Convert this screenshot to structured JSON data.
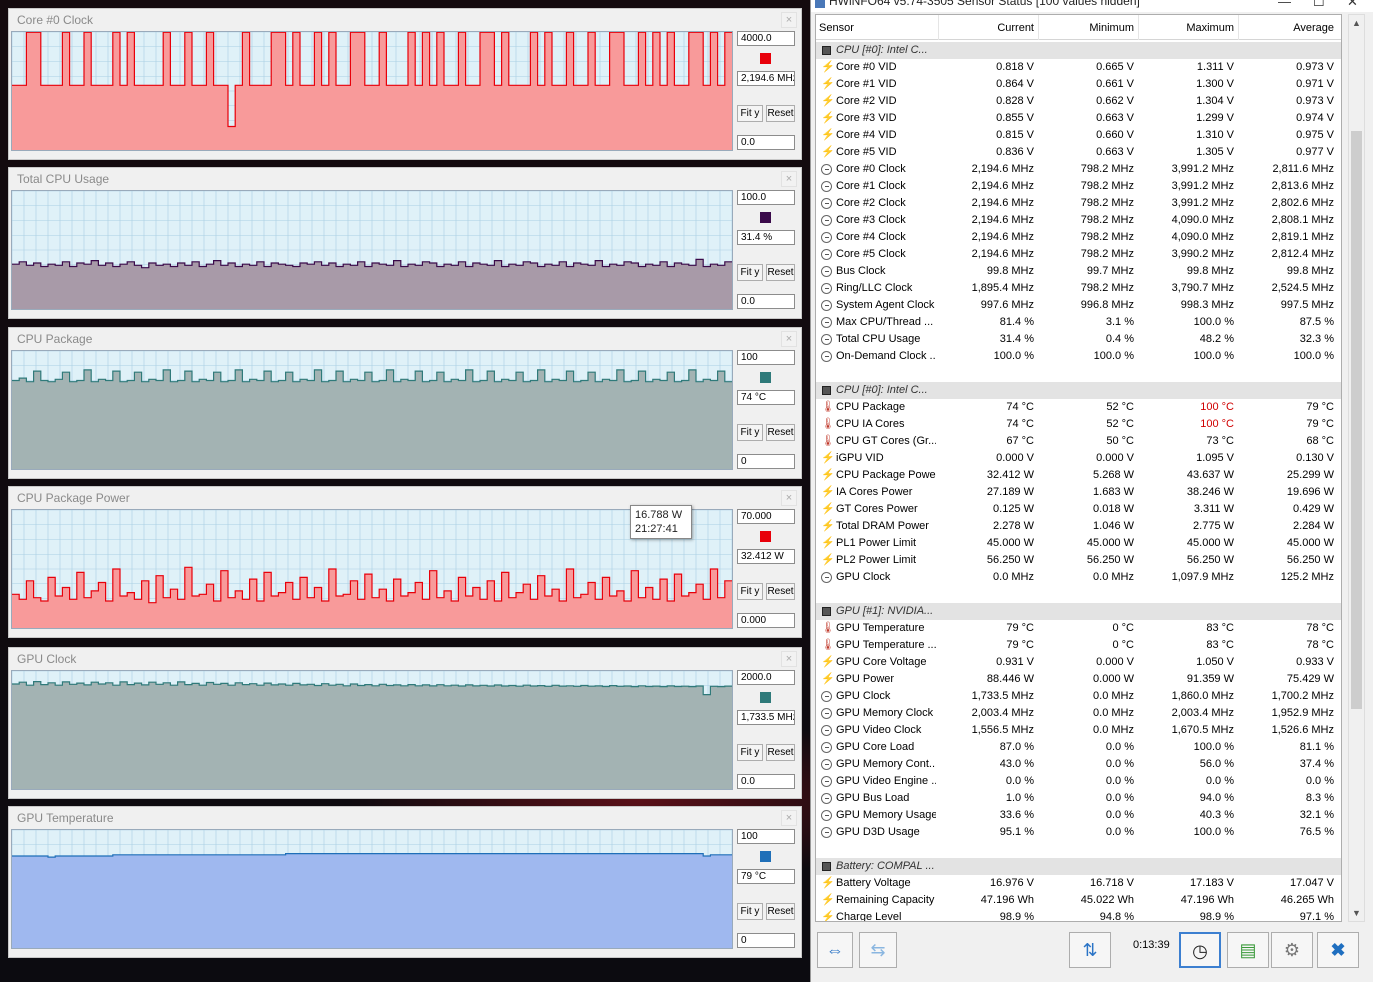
{
  "graphs": [
    {
      "title": "Core #0 Clock",
      "max": "4000.0",
      "current": "2,194.6 MHz",
      "min": "0.0",
      "color": "#e8000a",
      "fill": "#f89a9a",
      "bg": "#dff1f8",
      "series": [
        2194.6,
        2194.6,
        3990,
        3990,
        2194.6,
        2194.6,
        2194.6,
        3990,
        2194.6,
        2194.6,
        3990,
        2194.6,
        2194.6,
        2194.6,
        3990,
        2194.6,
        3990,
        2194.6,
        2194.6,
        2194.6,
        2194.6,
        3990,
        2194.6,
        2194.6,
        3990,
        2194.6,
        2194.6,
        3990,
        2194.6,
        2194.6,
        798,
        2194.6,
        3990,
        2194.6,
        2194.6,
        2194.6,
        3990,
        3990,
        2194.6,
        3990,
        2194.6,
        2194.6,
        3990,
        2194.6,
        3990,
        2194.6,
        2194.6,
        3990,
        3990,
        2194.6,
        2194.6,
        3990,
        2194.6,
        2194.6,
        2194.6,
        3990,
        2194.6,
        3990,
        2194.6,
        3990,
        2194.6,
        2194.6,
        3990,
        2194.6,
        2194.6,
        3990,
        3990,
        2194.6,
        3990,
        2194.6,
        2194.6,
        2194.6,
        3990,
        2194.6,
        3990,
        2194.6,
        2194.6,
        3990,
        2194.6,
        2194.6,
        3990,
        2194.6,
        2194.6,
        3990,
        3990,
        2194.6,
        2194.6,
        3990,
        2194.6,
        3990,
        2194.6,
        3990,
        2194.6,
        2194.6,
        3990,
        3990,
        2194.6,
        3990,
        2194.6,
        3990
      ]
    },
    {
      "title": "Total CPU Usage",
      "max": "100.0",
      "current": "31.4 %",
      "min": "0.0",
      "color": "#3a0a4a",
      "fill": "#a89aa8",
      "bg": "#dff1f8",
      "series": [
        38,
        40,
        37,
        39,
        36,
        38,
        37,
        40,
        36,
        39,
        38,
        41,
        37,
        39,
        36,
        38,
        40,
        37,
        35,
        39,
        37,
        38,
        36,
        39,
        37,
        40,
        36,
        38,
        41,
        37,
        39,
        36,
        38,
        37,
        40,
        36,
        39,
        38,
        37,
        36,
        39,
        38,
        40,
        37,
        39,
        36,
        38,
        37,
        40,
        36,
        39,
        38,
        37,
        41,
        36,
        38,
        37,
        40,
        39,
        36,
        38,
        37,
        40,
        36,
        39,
        38,
        37,
        41,
        36,
        38,
        37,
        40,
        39,
        36,
        38,
        37,
        40,
        36,
        39,
        38,
        37,
        41,
        36,
        38,
        37,
        40,
        39,
        36,
        38,
        37,
        40,
        36,
        39,
        38,
        37,
        42,
        36,
        38,
        37,
        40
      ]
    },
    {
      "title": "CPU Package",
      "max": "100",
      "current": "74 °C",
      "min": "0",
      "color": "#2f7a7a",
      "fill": "#a3b3b3",
      "bg": "#dff1f8",
      "series": [
        75,
        77,
        74,
        83,
        75,
        74,
        76,
        82,
        74,
        75,
        84,
        74,
        76,
        75,
        83,
        74,
        75,
        82,
        74,
        76,
        75,
        84,
        74,
        75,
        83,
        74,
        76,
        75,
        82,
        74,
        75,
        84,
        74,
        76,
        75,
        83,
        74,
        75,
        82,
        74,
        76,
        75,
        84,
        74,
        75,
        83,
        74,
        76,
        75,
        82,
        74,
        75,
        84,
        74,
        76,
        75,
        83,
        74,
        75,
        82,
        74,
        76,
        75,
        84,
        74,
        75,
        83,
        74,
        76,
        75,
        82,
        74,
        75,
        84,
        74,
        76,
        75,
        83,
        74,
        75,
        82,
        74,
        76,
        75,
        84,
        74,
        75,
        83,
        74,
        76,
        75,
        82,
        74,
        75,
        84,
        74,
        76,
        75,
        83,
        74
      ]
    },
    {
      "title": "CPU Package Power",
      "max": "70.000",
      "current": "32.412 W",
      "min": "0.000",
      "color": "#e8000a",
      "fill": "#f89a9a",
      "bg": "#dff1f8",
      "series": [
        20,
        17,
        28,
        18,
        16,
        30,
        19,
        24,
        17,
        33,
        18,
        22,
        27,
        16,
        35,
        19,
        21,
        17,
        28,
        15,
        31,
        18,
        23,
        17,
        36,
        19,
        20,
        26,
        16,
        34,
        18,
        22,
        17,
        29,
        16,
        33,
        19,
        21,
        27,
        17,
        30,
        18,
        24,
        16,
        35,
        19,
        20,
        28,
        17,
        32,
        18,
        23,
        16,
        29,
        19,
        21,
        27,
        17,
        34,
        18,
        22,
        16,
        30,
        19,
        24,
        17,
        28,
        16,
        33,
        18,
        21,
        26,
        17,
        31,
        19,
        23,
        16,
        35,
        18,
        20,
        27,
        17,
        30,
        19,
        22,
        16,
        34,
        18,
        24,
        17,
        29,
        16,
        32,
        19,
        21,
        26,
        17,
        35,
        18,
        28
      ]
    },
    {
      "title": "GPU Clock",
      "max": "2000.0",
      "current": "1,733.5 MHz",
      "min": "0.0",
      "color": "#2f7a7a",
      "fill": "#a3b3b3",
      "bg": "#dff1f8",
      "series": [
        1780,
        1810,
        1760,
        1820,
        1770,
        1800,
        1760,
        1815,
        1775,
        1795,
        1765,
        1810,
        1780,
        1800,
        1760,
        1815,
        1770,
        1795,
        1765,
        1810,
        1775,
        1800,
        1760,
        1815,
        1770,
        1790,
        1760,
        1805,
        1775,
        1790,
        1760,
        1800,
        1770,
        1785,
        1760,
        1795,
        1765,
        1780,
        1760,
        1790,
        1765,
        1775,
        1755,
        1785,
        1760,
        1775,
        1750,
        1780,
        1755,
        1770,
        1750,
        1775,
        1755,
        1765,
        1750,
        1770,
        1750,
        1765,
        1748,
        1768,
        1750,
        1760,
        1745,
        1765,
        1748,
        1758,
        1745,
        1762,
        1746,
        1755,
        1742,
        1760,
        1745,
        1752,
        1740,
        1758,
        1744,
        1750,
        1740,
        1755,
        1742,
        1748,
        1738,
        1752,
        1740,
        1746,
        1736,
        1750,
        1738,
        1744,
        1736,
        1748,
        1738,
        1742,
        1735,
        1746,
        1600,
        1740,
        1736,
        1744
      ]
    },
    {
      "title": "GPU Temperature",
      "max": "100",
      "current": "79 °C",
      "min": "0",
      "color": "#1f6fb8",
      "fill": "#9fb8ef",
      "bg": "#dff1f8",
      "series": [
        78,
        78,
        78,
        78,
        78,
        77,
        78,
        78,
        78,
        78,
        78,
        78,
        78,
        78,
        79,
        79,
        79,
        79,
        79,
        79,
        79,
        79,
        79,
        79,
        79,
        79,
        79,
        79,
        79,
        79,
        79,
        79,
        79,
        79,
        79,
        79,
        79,
        79,
        80,
        80,
        80,
        80,
        80,
        80,
        80,
        80,
        80,
        80,
        80,
        80,
        80,
        80,
        80,
        80,
        80,
        80,
        80,
        80,
        80,
        80,
        80,
        80,
        80,
        80,
        80,
        80,
        80,
        80,
        80,
        80,
        80,
        80,
        80,
        80,
        80,
        80,
        80,
        80,
        80,
        80,
        80,
        80,
        80,
        80,
        80,
        80,
        80,
        80,
        80,
        80,
        80,
        80,
        80,
        80,
        80,
        80,
        78,
        79,
        79,
        79
      ]
    }
  ],
  "fit_label": "Fit y",
  "reset_label": "Reset",
  "tooltip": {
    "value": "16.788 W",
    "time": "21:27:41"
  },
  "hw": {
    "title": "HWiNFO64 v5.74-3505 Sensor Status [100 values hidden]",
    "headers": [
      "Sensor",
      "Current",
      "Minimum",
      "Maximum",
      "Average"
    ],
    "rows": [
      {
        "t": "sec",
        "n": "CPU [#0]: Intel C..."
      },
      {
        "i": "volt",
        "n": "Core #0 VID",
        "v": [
          "0.818 V",
          "0.665 V",
          "1.311 V",
          "0.973 V"
        ]
      },
      {
        "i": "volt",
        "n": "Core #1 VID",
        "v": [
          "0.864 V",
          "0.661 V",
          "1.300 V",
          "0.971 V"
        ]
      },
      {
        "i": "volt",
        "n": "Core #2 VID",
        "v": [
          "0.828 V",
          "0.662 V",
          "1.304 V",
          "0.973 V"
        ]
      },
      {
        "i": "volt",
        "n": "Core #3 VID",
        "v": [
          "0.855 V",
          "0.663 V",
          "1.299 V",
          "0.974 V"
        ]
      },
      {
        "i": "volt",
        "n": "Core #4 VID",
        "v": [
          "0.815 V",
          "0.660 V",
          "1.310 V",
          "0.975 V"
        ]
      },
      {
        "i": "volt",
        "n": "Core #5 VID",
        "v": [
          "0.836 V",
          "0.663 V",
          "1.305 V",
          "0.977 V"
        ]
      },
      {
        "i": "clock",
        "n": "Core #0 Clock",
        "v": [
          "2,194.6 MHz",
          "798.2 MHz",
          "3,991.2 MHz",
          "2,811.6 MHz"
        ]
      },
      {
        "i": "clock",
        "n": "Core #1 Clock",
        "v": [
          "2,194.6 MHz",
          "798.2 MHz",
          "3,991.2 MHz",
          "2,813.6 MHz"
        ]
      },
      {
        "i": "clock",
        "n": "Core #2 Clock",
        "v": [
          "2,194.6 MHz",
          "798.2 MHz",
          "3,991.2 MHz",
          "2,802.6 MHz"
        ]
      },
      {
        "i": "clock",
        "n": "Core #3 Clock",
        "v": [
          "2,194.6 MHz",
          "798.2 MHz",
          "4,090.0 MHz",
          "2,808.1 MHz"
        ]
      },
      {
        "i": "clock",
        "n": "Core #4 Clock",
        "v": [
          "2,194.6 MHz",
          "798.2 MHz",
          "4,090.0 MHz",
          "2,819.1 MHz"
        ]
      },
      {
        "i": "clock",
        "n": "Core #5 Clock",
        "v": [
          "2,194.6 MHz",
          "798.2 MHz",
          "3,990.2 MHz",
          "2,812.4 MHz"
        ]
      },
      {
        "i": "clock",
        "n": "Bus Clock",
        "v": [
          "99.8 MHz",
          "99.7 MHz",
          "99.8 MHz",
          "99.8 MHz"
        ]
      },
      {
        "i": "clock",
        "n": "Ring/LLC Clock",
        "v": [
          "1,895.4 MHz",
          "798.2 MHz",
          "3,790.7 MHz",
          "2,524.5 MHz"
        ]
      },
      {
        "i": "clock",
        "n": "System Agent Clock",
        "v": [
          "997.6 MHz",
          "996.8 MHz",
          "998.3 MHz",
          "997.5 MHz"
        ]
      },
      {
        "i": "clock",
        "n": "Max CPU/Thread ...",
        "v": [
          "81.4 %",
          "3.1 %",
          "100.0 %",
          "87.5 %"
        ]
      },
      {
        "i": "clock",
        "n": "Total CPU Usage",
        "v": [
          "31.4 %",
          "0.4 %",
          "48.2 %",
          "32.3 %"
        ]
      },
      {
        "i": "clock",
        "n": "On-Demand Clock ...",
        "v": [
          "100.0 %",
          "100.0 %",
          "100.0 %",
          "100.0 %"
        ]
      },
      {
        "t": "blank"
      },
      {
        "t": "sec",
        "n": "CPU [#0]: Intel C..."
      },
      {
        "i": "temp",
        "n": "CPU Package",
        "v": [
          "74 °C",
          "52 °C",
          "100 °C",
          "79 °C"
        ],
        "red": 2
      },
      {
        "i": "temp",
        "n": "CPU IA Cores",
        "v": [
          "74 °C",
          "52 °C",
          "100 °C",
          "79 °C"
        ],
        "red": 2
      },
      {
        "i": "temp",
        "n": "CPU GT Cores (Gr...",
        "v": [
          "67 °C",
          "50 °C",
          "73 °C",
          "68 °C"
        ]
      },
      {
        "i": "volt",
        "n": "iGPU VID",
        "v": [
          "0.000 V",
          "0.000 V",
          "1.095 V",
          "0.130 V"
        ]
      },
      {
        "i": "volt",
        "n": "CPU Package Power",
        "v": [
          "32.412 W",
          "5.268 W",
          "43.637 W",
          "25.299 W"
        ]
      },
      {
        "i": "volt",
        "n": "IA Cores Power",
        "v": [
          "27.189 W",
          "1.683 W",
          "38.246 W",
          "19.696 W"
        ]
      },
      {
        "i": "volt",
        "n": "GT Cores Power",
        "v": [
          "0.125 W",
          "0.018 W",
          "3.311 W",
          "0.429 W"
        ]
      },
      {
        "i": "volt",
        "n": "Total DRAM Power",
        "v": [
          "2.278 W",
          "1.046 W",
          "2.775 W",
          "2.284 W"
        ]
      },
      {
        "i": "volt",
        "n": "PL1 Power Limit",
        "v": [
          "45.000 W",
          "45.000 W",
          "45.000 W",
          "45.000 W"
        ]
      },
      {
        "i": "volt",
        "n": "PL2 Power Limit",
        "v": [
          "56.250 W",
          "56.250 W",
          "56.250 W",
          "56.250 W"
        ]
      },
      {
        "i": "clock",
        "n": "GPU Clock",
        "v": [
          "0.0 MHz",
          "0.0 MHz",
          "1,097.9 MHz",
          "125.2 MHz"
        ]
      },
      {
        "t": "blank"
      },
      {
        "t": "sec",
        "n": "GPU [#1]: NVIDIA..."
      },
      {
        "i": "temp",
        "n": "GPU Temperature",
        "v": [
          "79 °C",
          "0 °C",
          "83 °C",
          "78 °C"
        ]
      },
      {
        "i": "temp",
        "n": "GPU Temperature ...",
        "v": [
          "79 °C",
          "0 °C",
          "83 °C",
          "78 °C"
        ]
      },
      {
        "i": "volt",
        "n": "GPU Core Voltage",
        "v": [
          "0.931 V",
          "0.000 V",
          "1.050 V",
          "0.933 V"
        ]
      },
      {
        "i": "volt",
        "n": "GPU Power",
        "v": [
          "88.446 W",
          "0.000 W",
          "91.359 W",
          "75.429 W"
        ]
      },
      {
        "i": "clock",
        "n": "GPU Clock",
        "v": [
          "1,733.5 MHz",
          "0.0 MHz",
          "1,860.0 MHz",
          "1,700.2 MHz"
        ]
      },
      {
        "i": "clock",
        "n": "GPU Memory Clock",
        "v": [
          "2,003.4 MHz",
          "0.0 MHz",
          "2,003.4 MHz",
          "1,952.9 MHz"
        ]
      },
      {
        "i": "clock",
        "n": "GPU Video Clock",
        "v": [
          "1,556.5 MHz",
          "0.0 MHz",
          "1,670.5 MHz",
          "1,526.6 MHz"
        ]
      },
      {
        "i": "clock",
        "n": "GPU Core Load",
        "v": [
          "87.0 %",
          "0.0 %",
          "100.0 %",
          "81.1 %"
        ]
      },
      {
        "i": "clock",
        "n": "GPU Memory Cont...",
        "v": [
          "43.0 %",
          "0.0 %",
          "56.0 %",
          "37.4 %"
        ]
      },
      {
        "i": "clock",
        "n": "GPU Video Engine ...",
        "v": [
          "0.0 %",
          "0.0 %",
          "0.0 %",
          "0.0 %"
        ]
      },
      {
        "i": "clock",
        "n": "GPU Bus Load",
        "v": [
          "1.0 %",
          "0.0 %",
          "94.0 %",
          "8.3 %"
        ]
      },
      {
        "i": "clock",
        "n": "GPU Memory Usage",
        "v": [
          "33.6 %",
          "0.0 %",
          "40.3 %",
          "32.1 %"
        ]
      },
      {
        "i": "clock",
        "n": "GPU D3D Usage",
        "v": [
          "95.1 %",
          "0.0 %",
          "100.0 %",
          "76.5 %"
        ]
      },
      {
        "t": "blank"
      },
      {
        "t": "sec",
        "n": "Battery: COMPAL ..."
      },
      {
        "i": "volt",
        "n": "Battery Voltage",
        "v": [
          "16.976 V",
          "16.718 V",
          "17.183 V",
          "17.047 V"
        ]
      },
      {
        "i": "volt",
        "n": "Remaining Capacity",
        "v": [
          "47.196 Wh",
          "45.022 Wh",
          "47.196 Wh",
          "46.265 Wh"
        ]
      },
      {
        "i": "volt",
        "n": "Charge Level",
        "v": [
          "98.9 %",
          "94.8 %",
          "98.9 %",
          "97.1 %"
        ]
      }
    ],
    "timer": "0:13:39"
  }
}
